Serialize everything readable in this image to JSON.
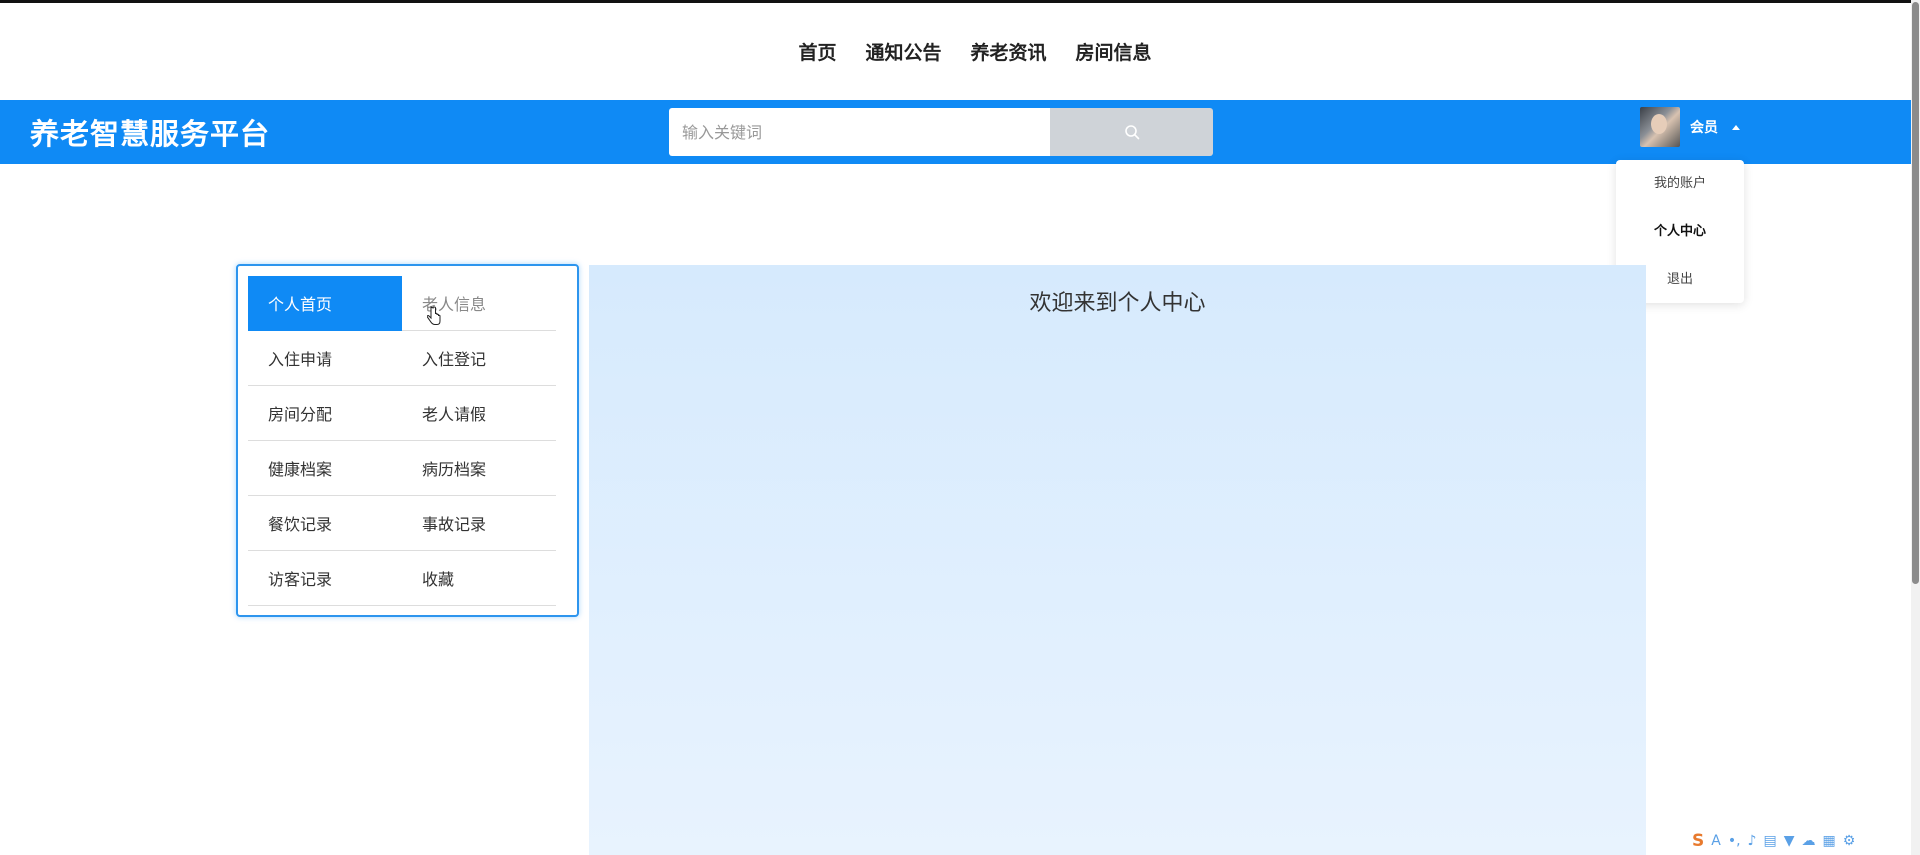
{
  "topnav": {
    "items": [
      {
        "label": "首页"
      },
      {
        "label": "通知公告"
      },
      {
        "label": "养老资讯"
      },
      {
        "label": "房间信息"
      }
    ]
  },
  "header": {
    "logo": "养老智慧服务平台",
    "search": {
      "placeholder": "输入关键词",
      "value": ""
    },
    "user": {
      "name": "会员"
    }
  },
  "dropdown": {
    "items": [
      {
        "label": "我的账户"
      },
      {
        "label": "个人中心"
      },
      {
        "label": "退出"
      }
    ]
  },
  "sidemenu": {
    "items": [
      {
        "label": "个人首页"
      },
      {
        "label": "老人信息"
      },
      {
        "label": "入住申请"
      },
      {
        "label": "入住登记"
      },
      {
        "label": "房间分配"
      },
      {
        "label": "老人请假"
      },
      {
        "label": "健康档案"
      },
      {
        "label": "病历档案"
      },
      {
        "label": "餐饮记录"
      },
      {
        "label": "事故记录"
      },
      {
        "label": "访客记录"
      },
      {
        "label": "收藏"
      }
    ]
  },
  "content": {
    "welcome": "欢迎来到个人中心"
  },
  "ime_toolbar": {
    "lang": "A"
  },
  "colors": {
    "primary": "#0f8af5",
    "search_button": "#cfd3d8",
    "content_bg": "#d6eafd"
  }
}
